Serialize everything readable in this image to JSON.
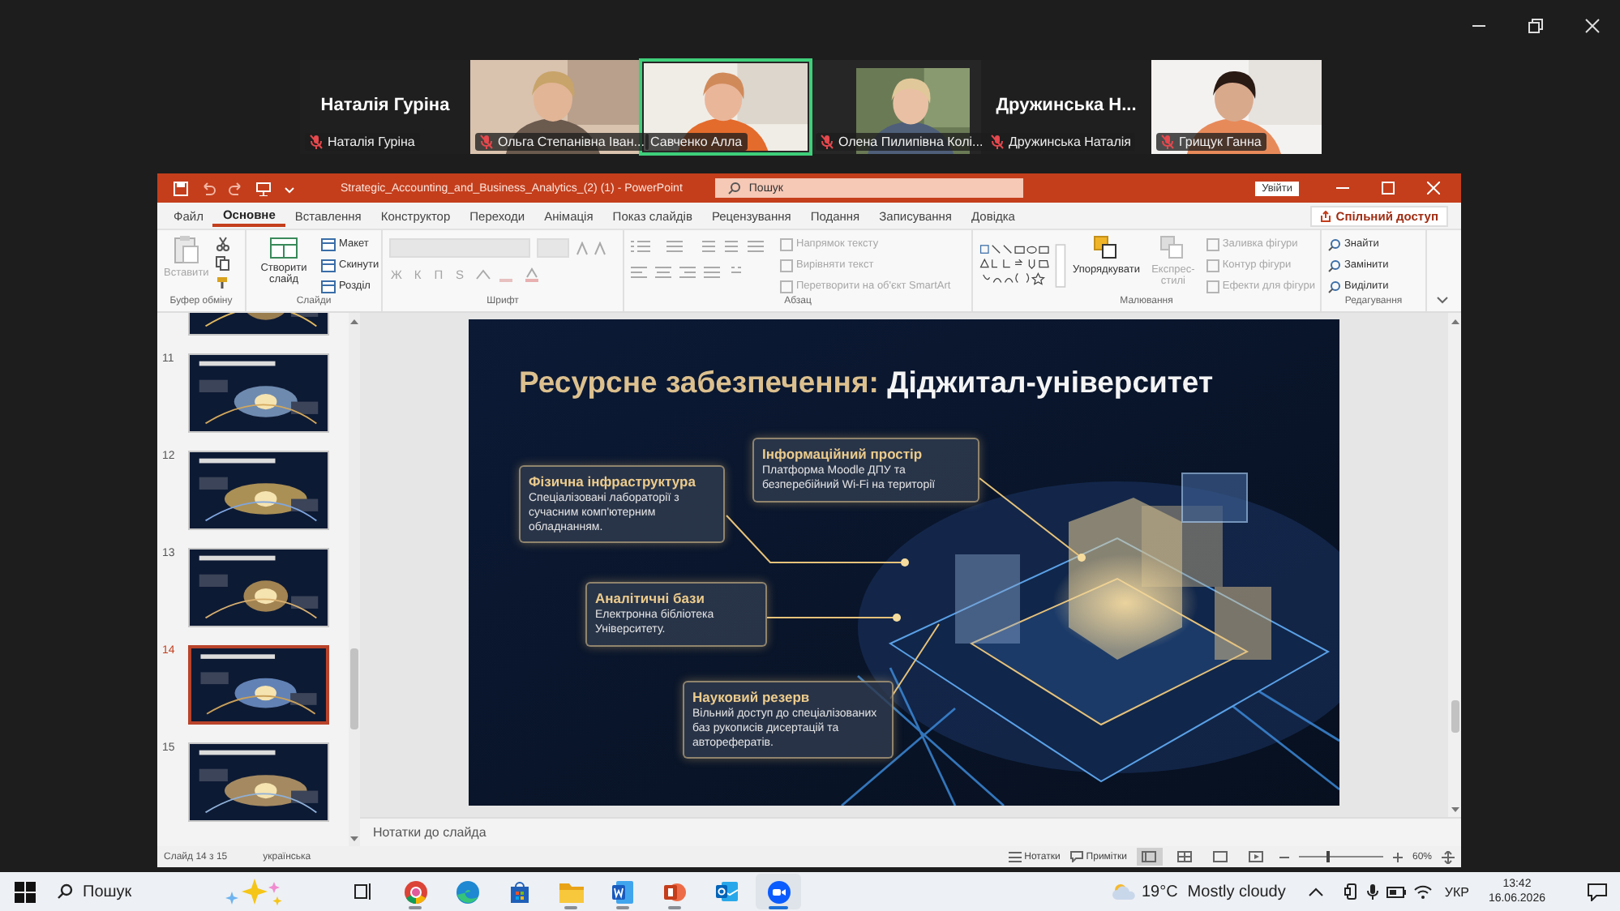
{
  "meeting": {
    "tiles": [
      {
        "kind": "name",
        "name": "Наталія Гуріна",
        "label": "Наталія Гуріна",
        "muted": true,
        "speaking": false
      },
      {
        "kind": "video",
        "label": "Ольга Степанівна Іван...",
        "muted": true,
        "speaking": false
      },
      {
        "kind": "video",
        "label": "Савченко Алла",
        "muted": false,
        "speaking": true
      },
      {
        "kind": "avatar",
        "label": "Олена Пилипівна Колі...",
        "muted": true,
        "speaking": false
      },
      {
        "kind": "name",
        "name": "Дружинська Н...",
        "label": "Дружинська Наталія",
        "muted": true,
        "speaking": false
      },
      {
        "kind": "video",
        "label": "Грищук Ганна",
        "muted": true,
        "speaking": false
      }
    ]
  },
  "window": {
    "title": "Strategic_Accounting_and_Business_Analytics_(2) (1)  -  PowerPoint",
    "search_placeholder": "Пошук",
    "sign_in": "Увійти"
  },
  "tabs": [
    {
      "label": "Файл",
      "selected": false
    },
    {
      "label": "Основне",
      "selected": true
    },
    {
      "label": "Вставлення",
      "selected": false
    },
    {
      "label": "Конструктор",
      "selected": false
    },
    {
      "label": "Переходи",
      "selected": false
    },
    {
      "label": "Анімація",
      "selected": false
    },
    {
      "label": "Показ слайдів",
      "selected": false
    },
    {
      "label": "Рецензування",
      "selected": false
    },
    {
      "label": "Подання",
      "selected": false
    },
    {
      "label": "Записування",
      "selected": false
    },
    {
      "label": "Довідка",
      "selected": false
    }
  ],
  "share_button": "Спільний доступ",
  "ribbon_groups": [
    {
      "kind": "clipboard",
      "label": "Буфер обміну",
      "buttons": [
        {
          "kind": "large",
          "label": "Вставити",
          "disabled": true
        }
      ]
    },
    {
      "kind": "slides",
      "label": "Слайди",
      "buttons": [
        {
          "kind": "large",
          "label": "Створити слайд",
          "disabled": false
        },
        {
          "kind": "small",
          "label": "Макет",
          "disabled": false
        },
        {
          "kind": "small",
          "label": "Скинути",
          "disabled": false
        },
        {
          "kind": "small",
          "label": "Розділ",
          "disabled": false
        }
      ]
    },
    {
      "kind": "font",
      "label": "Шрифт",
      "buttons": [
        {
          "kind": "glyph",
          "label": "Ж",
          "disabled": true
        },
        {
          "kind": "glyph",
          "label": "К",
          "disabled": true
        },
        {
          "kind": "glyph",
          "label": "П",
          "disabled": true
        },
        {
          "kind": "glyph",
          "label": "S",
          "disabled": true
        }
      ]
    },
    {
      "kind": "paragraph",
      "label": "Абзац",
      "buttons": [
        {
          "kind": "small",
          "label": "Напрямок тексту",
          "disabled": true
        },
        {
          "kind": "small",
          "label": "Вирівняти текст",
          "disabled": true
        },
        {
          "kind": "small",
          "label": "Перетворити на об'єкт SmartArt",
          "disabled": true
        }
      ]
    },
    {
      "kind": "drawing",
      "label": "Малювання",
      "buttons": [
        {
          "kind": "large",
          "label": "Упорядкувати",
          "disabled": false
        },
        {
          "kind": "large",
          "label": "Експрес-стилі",
          "disabled": true
        },
        {
          "kind": "small",
          "label": "Заливка фігури",
          "disabled": true
        },
        {
          "kind": "small",
          "label": "Контур фігури",
          "disabled": true
        },
        {
          "kind": "small",
          "label": "Ефекти для фігури",
          "disabled": true
        }
      ]
    },
    {
      "kind": "editing",
      "label": "Редагування",
      "buttons": [
        {
          "kind": "small",
          "label": "Знайти",
          "disabled": false
        },
        {
          "kind": "small",
          "label": "Замінити",
          "disabled": false
        },
        {
          "kind": "small",
          "label": "Виділити",
          "disabled": false
        }
      ]
    }
  ],
  "thumbnails": [
    {
      "selected": false
    },
    {
      "number": "11",
      "selected": false
    },
    {
      "number": "12",
      "selected": false
    },
    {
      "number": "13",
      "selected": false
    },
    {
      "number": "14",
      "selected": true
    },
    {
      "number": "15",
      "selected": false
    }
  ],
  "slide": {
    "title": {
      "lead": "Ресурсне забезпечення:",
      "main": "Діджитал-університет"
    },
    "cards": [
      {
        "title": "Інформаційний простір",
        "body": "Платформа Moodle ДПУ та безперебійний Wi-Fi на території"
      },
      {
        "title": "Фізична інфраструктура",
        "body": "Спеціалізовані лабораторії з сучасним комп'ютерним обладнанням."
      },
      {
        "title": "Аналітичні бази",
        "body": "Електронна бібліотека Університету."
      },
      {
        "title": "Науковий резерв",
        "body": "Вільний доступ до спеціалізованих баз рукописів дисертацій та авторефератів."
      }
    ]
  },
  "notes_placeholder": "Нотатки до слайда",
  "status_bar": {
    "slide": "Слайд 14 з 15",
    "language": "українська",
    "notes": "Нотатки",
    "comments": "Примітки",
    "views": [
      {
        "selected": true
      },
      {
        "selected": false
      },
      {
        "selected": false
      },
      {
        "selected": false
      }
    ],
    "zoom": {
      "level": 0.33,
      "reading": "60%"
    }
  },
  "taskbar": {
    "search_placeholder": "Пошук",
    "apps": [
      {
        "kind": "browser",
        "running": true,
        "selected": false
      },
      {
        "kind": "edge",
        "running": false,
        "selected": false
      },
      {
        "kind": "store",
        "running": false,
        "selected": false
      },
      {
        "kind": "folder",
        "running": true,
        "selected": false
      },
      {
        "kind": "document",
        "running": true,
        "selected": false
      },
      {
        "kind": "presentation",
        "running": true,
        "selected": false
      },
      {
        "kind": "mail",
        "running": false,
        "selected": false
      },
      {
        "kind": "video",
        "running": true,
        "selected": true
      }
    ],
    "weather": {
      "temperature": "19°C",
      "condition": "Mostly cloudy"
    },
    "language": "УКР",
    "time": "13:42",
    "date": "16.06.2026"
  }
}
